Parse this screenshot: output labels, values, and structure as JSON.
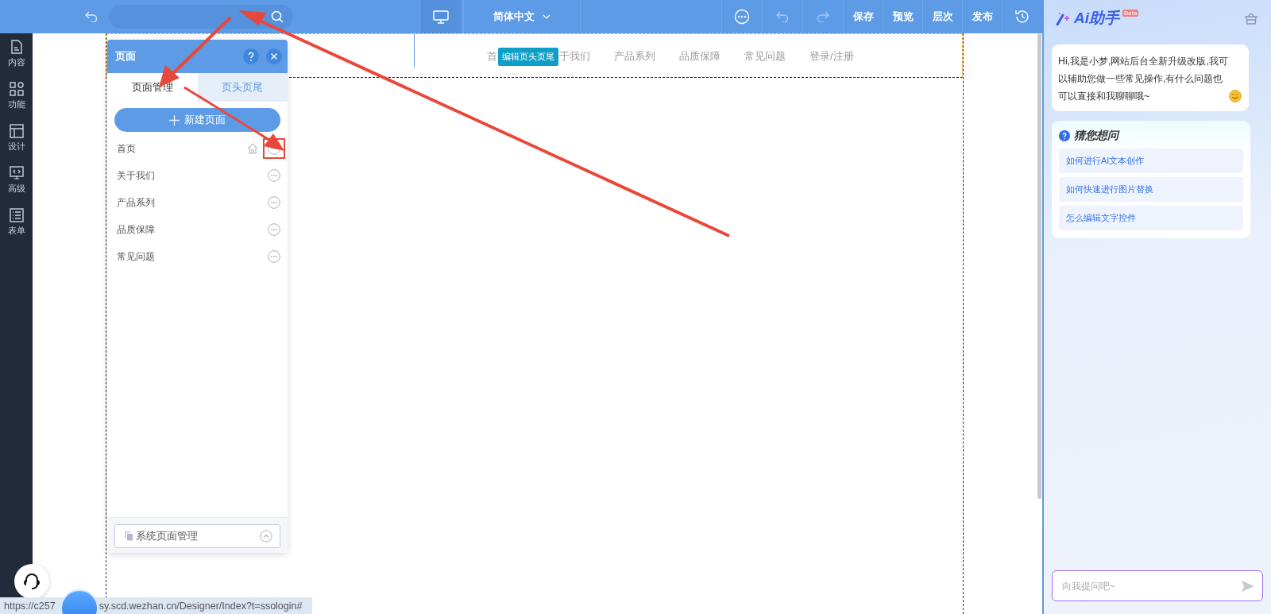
{
  "toolbar": {
    "language": "简体中文",
    "actions": [
      "保存",
      "预览",
      "层次",
      "发布"
    ]
  },
  "sidebar": {
    "items": [
      {
        "label": "内容",
        "kind": "document"
      },
      {
        "label": "功能",
        "kind": "grid"
      },
      {
        "label": "设计",
        "kind": "layout"
      },
      {
        "label": "高级",
        "kind": "code"
      },
      {
        "label": "表单",
        "kind": "form"
      }
    ]
  },
  "canvas": {
    "nav": [
      "首",
      "于我们",
      "产品系列",
      "品质保障",
      "常见问题",
      "登录/注册"
    ],
    "badge": "编辑页头页尾"
  },
  "page_panel": {
    "title": "页面",
    "tabs": [
      {
        "label": "页面管理",
        "selected": true
      },
      {
        "label": "页头页尾",
        "selected": false
      }
    ],
    "new_button": "新建页面",
    "pages": [
      {
        "name": "首页",
        "home": true
      },
      {
        "name": "关于我们",
        "home": false
      },
      {
        "name": "产品系列",
        "home": false
      },
      {
        "name": "品质保障",
        "home": false
      },
      {
        "name": "常见问题",
        "home": false
      }
    ],
    "footer_button": "系统页面管理"
  },
  "assistant": {
    "title": "Ai助手",
    "badge": "Beta",
    "greeting": "Hi,我是小梦,网站后台全新升级改版,我可以辅助您做一些常见操作,有什么问题也可以直接和我聊聊哦~",
    "suggest_title": "猜您想问",
    "suggestions": [
      "如何进行AI文本创作",
      "如何快速进行图片替换",
      "怎么编辑文字控件"
    ],
    "input": {
      "placeholder": "向我提问吧~"
    }
  },
  "status_bar": [
    "https://c257",
    "sy.scd.wezhan.cn/Designer/Index?t=ssologin#"
  ]
}
